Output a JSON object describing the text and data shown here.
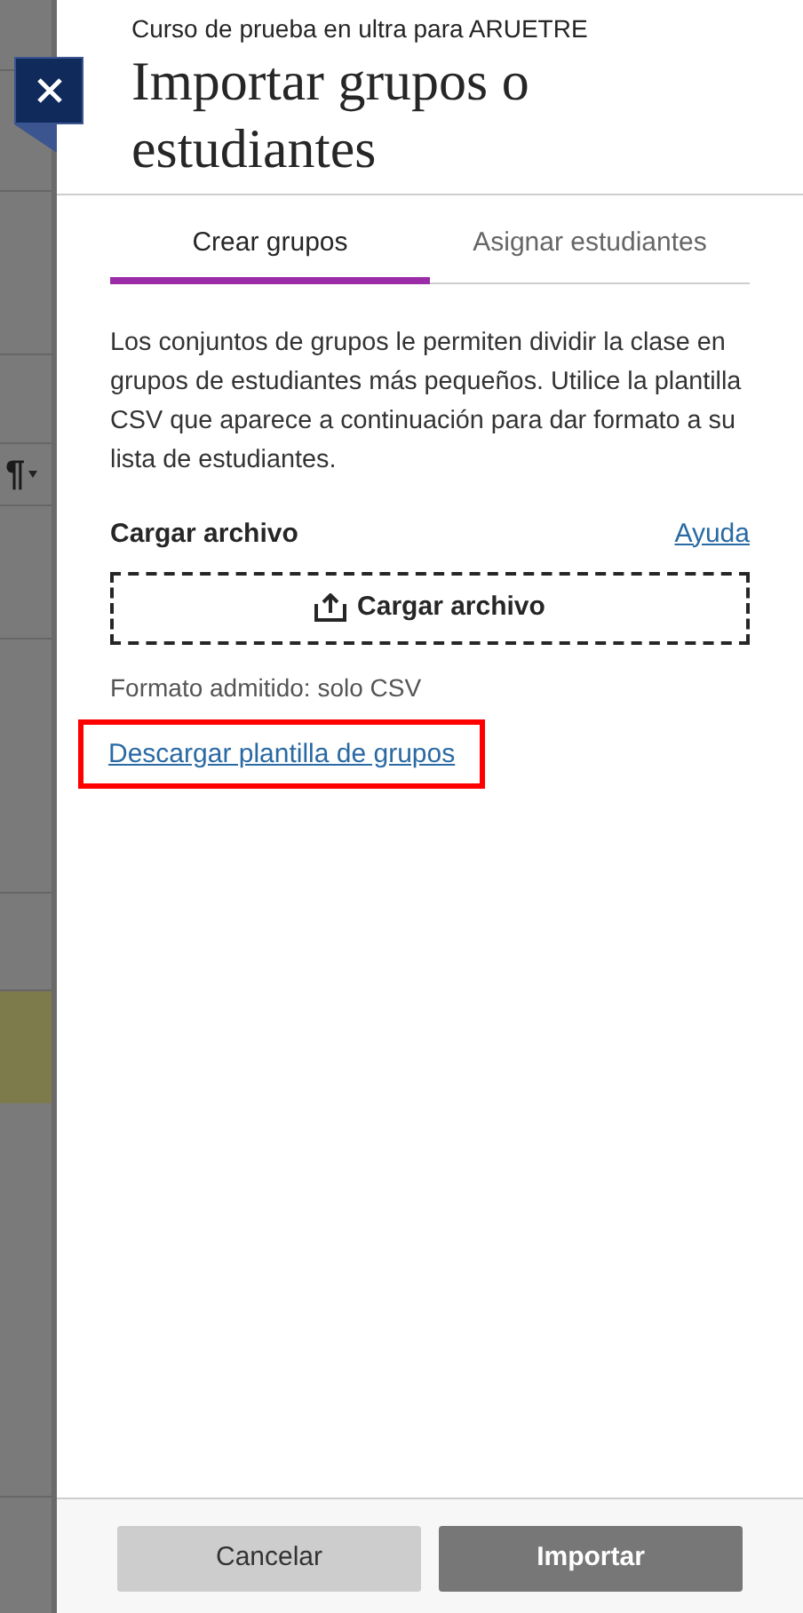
{
  "background": {
    "toolbar_glyph": "¶"
  },
  "panel": {
    "course": "Curso de prueba en ultra para ARUETRE",
    "title": "Importar grupos o estudiantes"
  },
  "tabs": [
    {
      "label": "Crear grupos",
      "selected": true
    },
    {
      "label": "Asignar estudiantes",
      "selected": false
    }
  ],
  "description": "Los conjuntos de grupos le permiten dividir la clase en grupos de estudiantes más pequeños. Utilice la plantilla CSV que aparece a continuación para dar formato a su lista de estudiantes.",
  "upload": {
    "label": "Cargar archivo",
    "help_link": "Ayuda",
    "button": "Cargar archivo",
    "note": "Formato admitido: solo CSV"
  },
  "download_link": {
    "text": "Descargar plantilla de grupos",
    "highlighted": true
  },
  "buttons": [
    {
      "label": "Cancelar",
      "kind": "secondary"
    },
    {
      "label": "Importar",
      "kind": "primary"
    }
  ]
}
